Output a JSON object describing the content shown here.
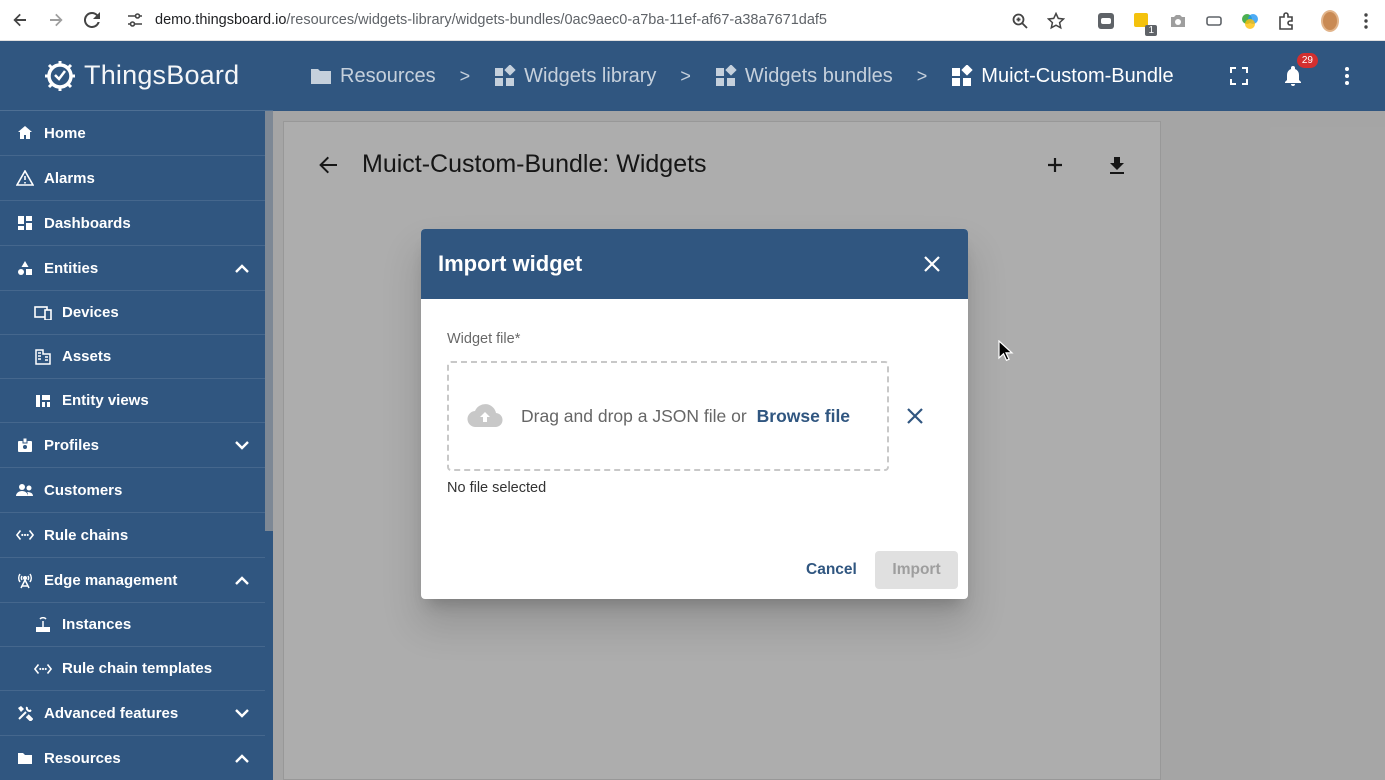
{
  "browser": {
    "url_host": "demo.thingsboard.io",
    "url_path": "/resources/widgets-library/widgets-bundles/0ac9aec0-a7ba-11ef-af67-a38a7671daf5",
    "extension_badge": "1"
  },
  "sidebar": {
    "logo": "ThingsBoard",
    "items": [
      {
        "label": "Home",
        "icon": "home-icon"
      },
      {
        "label": "Alarms",
        "icon": "warning-icon"
      },
      {
        "label": "Dashboards",
        "icon": "dashboard-icon"
      },
      {
        "label": "Entities",
        "icon": "category-icon",
        "expanded": true
      },
      {
        "label": "Devices",
        "icon": "devices-icon"
      },
      {
        "label": "Assets",
        "icon": "domain-icon"
      },
      {
        "label": "Entity views",
        "icon": "view-quilt-icon"
      },
      {
        "label": "Profiles",
        "icon": "badge-icon",
        "expanded": false
      },
      {
        "label": "Customers",
        "icon": "supervisor-icon"
      },
      {
        "label": "Rule chains",
        "icon": "settings-ethernet-icon"
      },
      {
        "label": "Edge management",
        "icon": "router-icon",
        "expanded": true
      },
      {
        "label": "Instances",
        "icon": "edge-icon"
      },
      {
        "label": "Rule chain templates",
        "icon": "settings-ethernet-icon"
      },
      {
        "label": "Advanced features",
        "icon": "construction-icon",
        "expanded": false
      },
      {
        "label": "Resources",
        "icon": "folder-icon",
        "expanded": true
      }
    ]
  },
  "breadcrumb": {
    "items": [
      "Resources",
      "Widgets library",
      "Widgets bundles",
      "Muict-Custom-Bundle"
    ],
    "separator": ">"
  },
  "notifications": {
    "count": "29"
  },
  "page": {
    "title": "Muict-Custom-Bundle: Widgets"
  },
  "dialog": {
    "title": "Import widget",
    "field_label": "Widget file*",
    "drop_text": "Drag and drop a JSON file or",
    "browse_label": "Browse file",
    "status": "No file selected",
    "cancel_label": "Cancel",
    "import_label": "Import"
  },
  "colors": {
    "primary": "#305680",
    "badge": "#d32f2f"
  }
}
